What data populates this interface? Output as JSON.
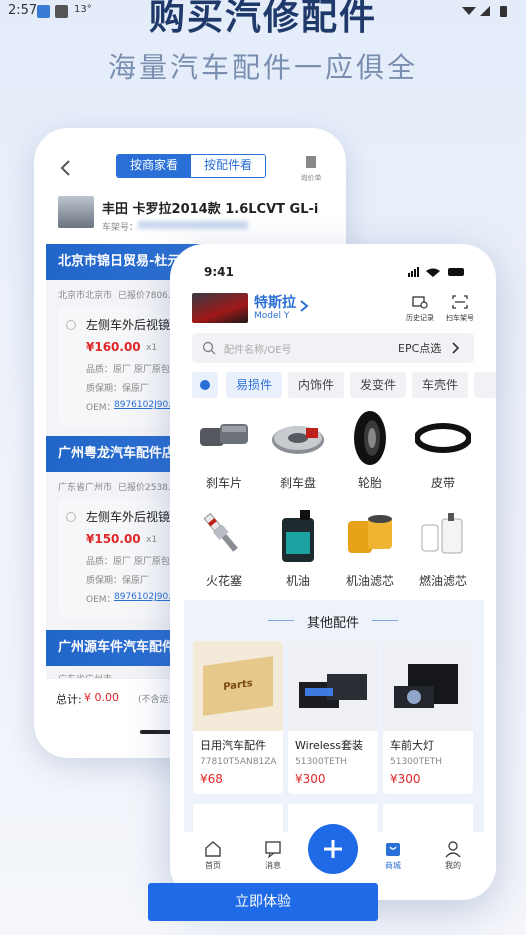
{
  "status_bar": {
    "time": "2:57",
    "extra": "13°"
  },
  "hero": {
    "title": "购买汽修配件",
    "subtitle": "海量汽车配件一应俱全"
  },
  "back_screen": {
    "tabs": [
      {
        "label": "按商家看"
      },
      {
        "label": "按配件看"
      }
    ],
    "quote_label": "询价单",
    "car_name": "丰田 卡罗拉2014款 1.6LCVT GL-i",
    "frame_label": "车架号：",
    "shops": [
      {
        "name": "北京市锦日贸易-杜元…",
        "location": "北京市北京市",
        "quoted": "已报价7806…",
        "part": "左侧车外后视镜…",
        "price": "¥160.00",
        "qty": "x1",
        "quality": "品质：原厂 原厂原包…",
        "warranty": "质保期：保原厂",
        "oem_label": "OEM：",
        "oem": "8976102J90…"
      },
      {
        "name": "广州粤龙汽车配件店…",
        "location": "广东省广州市",
        "quoted": "已报价2538…",
        "part": "左侧车外后视镜…",
        "price": "¥150.00",
        "qty": "x1",
        "quality": "品质：原厂 原厂原包…",
        "warranty": "质保期：保原厂",
        "oem_label": "OEM：",
        "oem": "8976102J90…"
      },
      {
        "name": "广州源车件汽车配件…",
        "location": "广东省广州市"
      }
    ],
    "total_label": "总计:",
    "total_value": "¥ 0.00",
    "total_note": "(不含运费)"
  },
  "front_screen": {
    "time": "9:41",
    "car_brand": "特斯拉",
    "car_model": "Model Y",
    "actions": [
      {
        "label": "历史记录"
      },
      {
        "label": "扫车架号"
      }
    ],
    "search_placeholder": "配件名称/OE号",
    "search_epc": "EPC点选",
    "chips": [
      {
        "label": "易损件"
      },
      {
        "label": "内饰件"
      },
      {
        "label": "发变件"
      },
      {
        "label": "车壳件"
      }
    ],
    "categories": [
      {
        "label": "刹车片"
      },
      {
        "label": "刹车盘"
      },
      {
        "label": "轮胎"
      },
      {
        "label": "皮带"
      },
      {
        "label": "火花塞"
      },
      {
        "label": "机油"
      },
      {
        "label": "机油滤芯"
      },
      {
        "label": "燃油滤芯"
      }
    ],
    "other_title": "其他配件",
    "products": [
      {
        "name": "日用汽车配件",
        "code": "77810T5AN81ZA",
        "price": "¥68",
        "pic_text": "Parts"
      },
      {
        "name": "Wireless套装",
        "code": "51300TETH",
        "price": "¥300"
      },
      {
        "name": "车前大灯",
        "code": "51300TETH",
        "price": "¥300"
      }
    ],
    "tabbar": [
      {
        "label": "首页"
      },
      {
        "label": "消息"
      },
      {
        "label": "商城"
      },
      {
        "label": "我的"
      }
    ],
    "colors": {
      "accent": "#2a6fd6",
      "price": "#e02828"
    }
  },
  "cta": {
    "label": "立即体验"
  }
}
